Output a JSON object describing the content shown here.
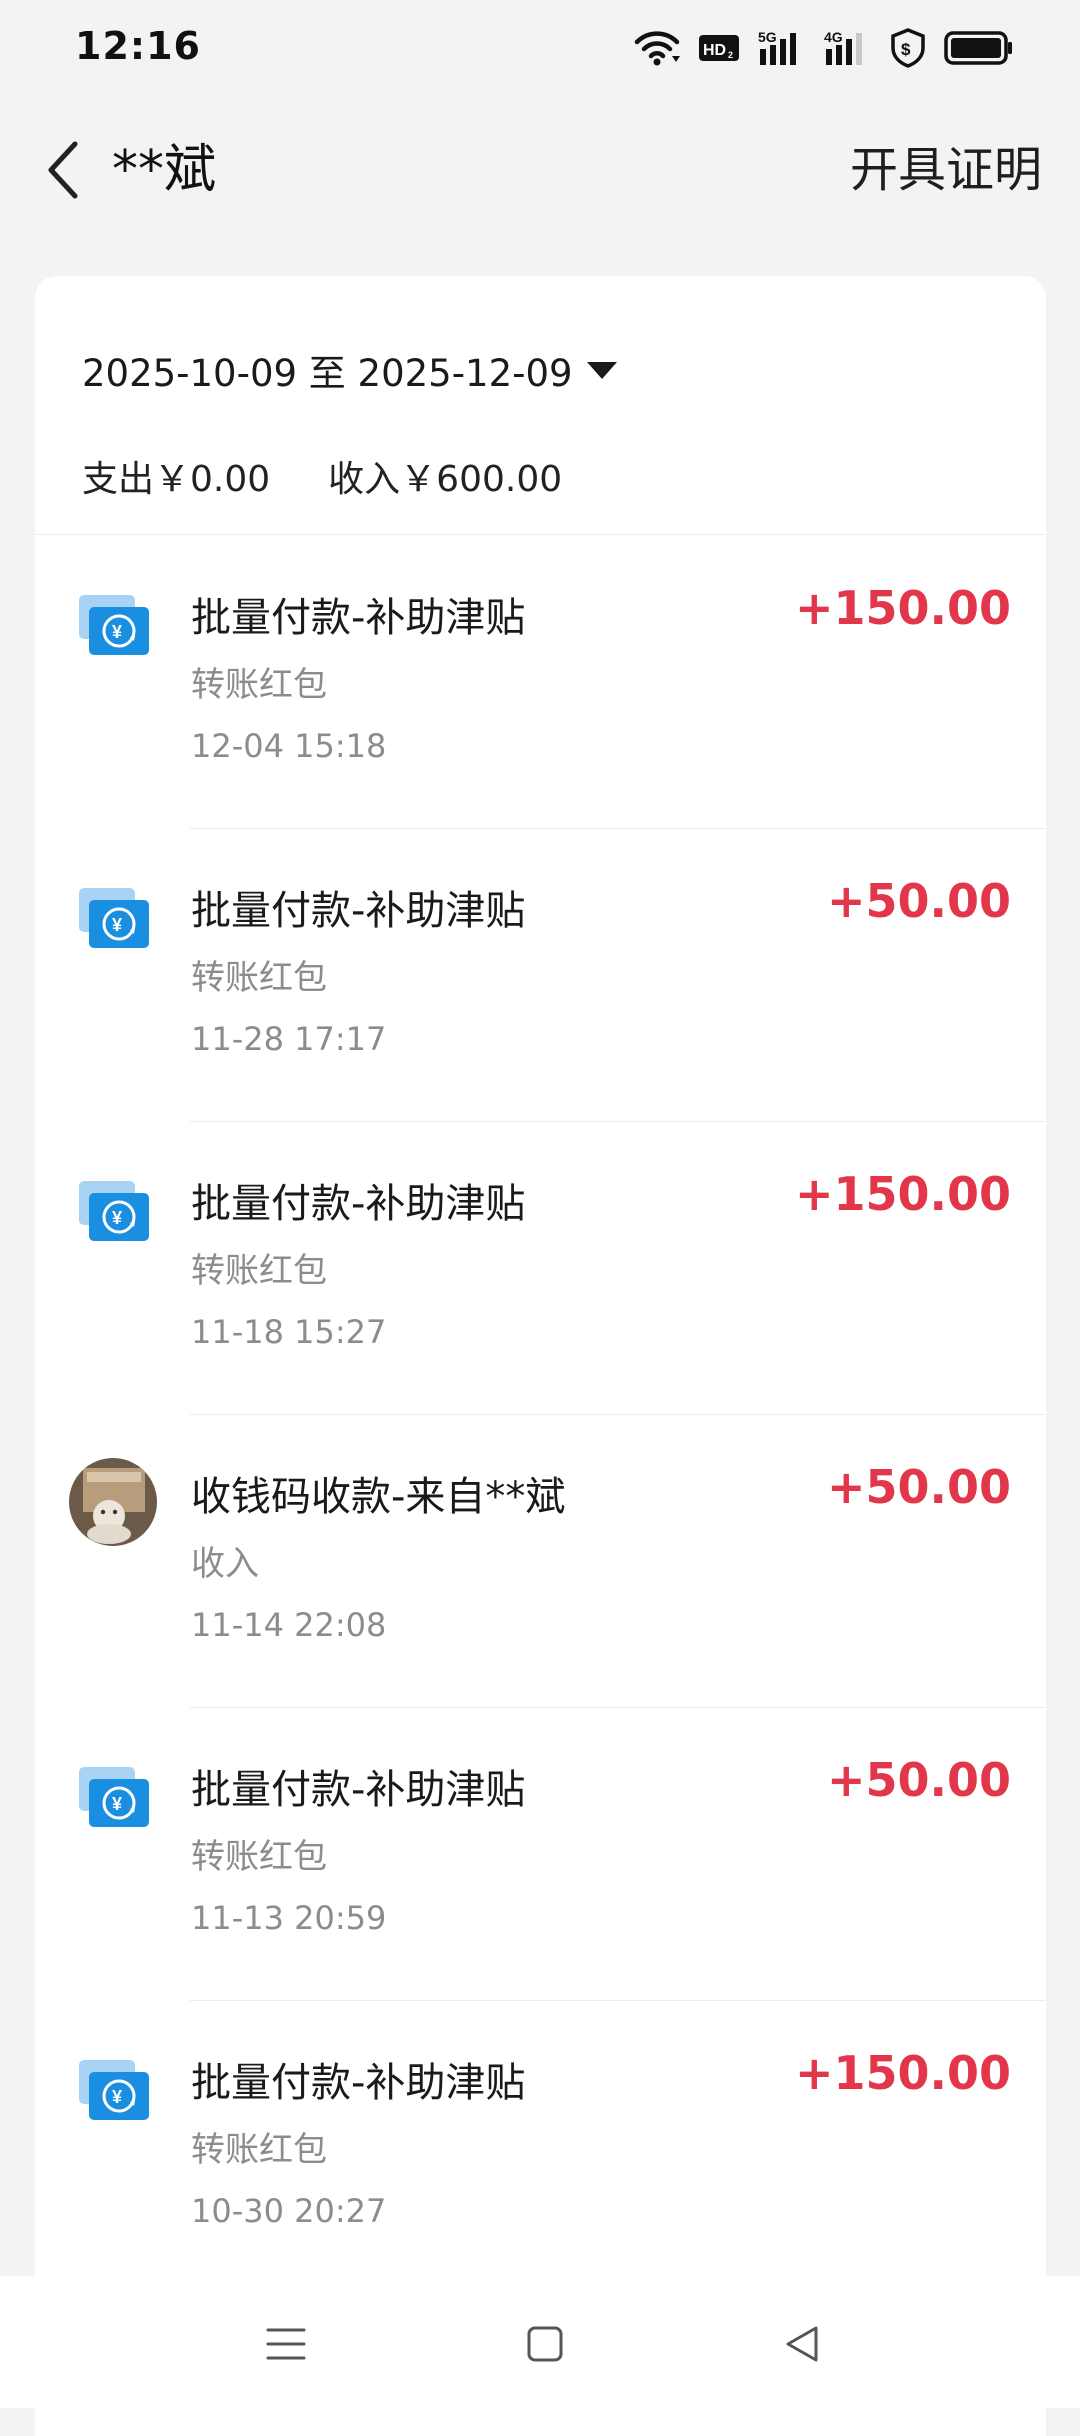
{
  "status_bar": {
    "time": "12:16",
    "icons": [
      "wifi-icon",
      "hd-icon",
      "signal-5g-icon",
      "signal-4g-icon",
      "shield-icon",
      "battery-icon"
    ]
  },
  "header": {
    "title": "**斌",
    "action": "开具证明"
  },
  "filter": {
    "date_range": "2025-10-09 至 2025-12-09"
  },
  "summary": {
    "expense": "支出￥0.00",
    "income": "收入￥600.00"
  },
  "transactions": [
    {
      "title": "批量付款-补助津贴",
      "type": "转账红包",
      "time": "12-04 15:18",
      "amount": "+150.00",
      "icon": "transfer-icon"
    },
    {
      "title": "批量付款-补助津贴",
      "type": "转账红包",
      "time": "11-28 17:17",
      "amount": "+50.00",
      "icon": "transfer-icon"
    },
    {
      "title": "批量付款-补助津贴",
      "type": "转账红包",
      "time": "11-18 15:27",
      "amount": "+150.00",
      "icon": "transfer-icon"
    },
    {
      "title": "收钱码收款-来自**斌",
      "type": "收入",
      "time": "11-14 22:08",
      "amount": "+50.00",
      "icon": "avatar"
    },
    {
      "title": "批量付款-补助津贴",
      "type": "转账红包",
      "time": "11-13 20:59",
      "amount": "+50.00",
      "icon": "transfer-icon"
    },
    {
      "title": "批量付款-补助津贴",
      "type": "转账红包",
      "time": "10-30 20:27",
      "amount": "+150.00",
      "icon": "transfer-icon"
    }
  ],
  "colors": {
    "amount": "#e2364a",
    "icon_blue": "#1a8ee0",
    "background": "#f3f3f3"
  }
}
